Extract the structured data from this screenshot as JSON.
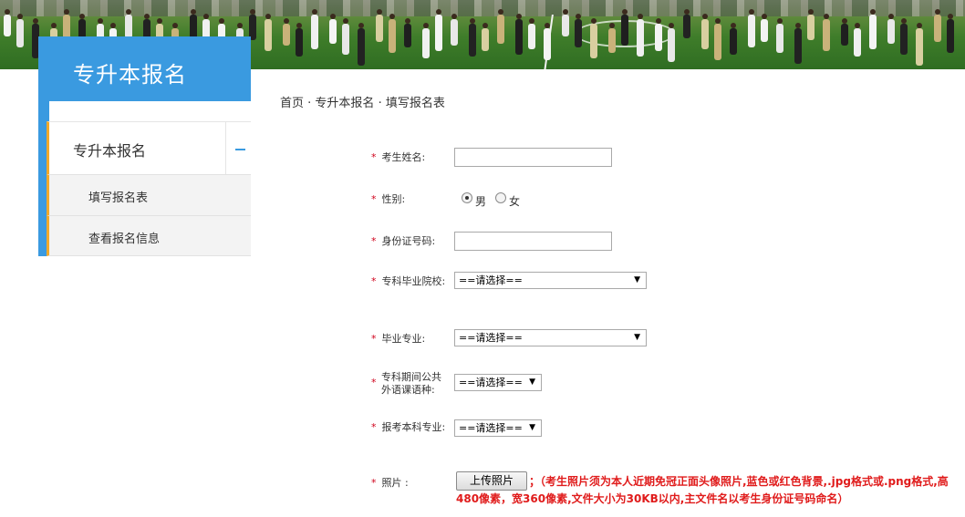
{
  "sidebar": {
    "title": "专升本报名",
    "menu_item": "专升本报名",
    "submenu": [
      "填写报名表",
      "查看报名信息"
    ]
  },
  "breadcrumb": {
    "home": "首页",
    "sep": " · ",
    "section": "专升本报名",
    "current": "填写报名表"
  },
  "form": {
    "required_mark": "*",
    "name_label": "考生姓名:",
    "gender_label": "性别:",
    "gender_options": [
      "男",
      "女"
    ],
    "gender_selected": "男",
    "id_label": "身份证号码:",
    "college_label": "专科毕业院校:",
    "college_value": "==请选择==",
    "major_label": "毕业专业:",
    "major_value": "==请选择==",
    "lang_label_line1": "专科期间公共",
    "lang_label_line2": "外语课语种:",
    "lang_value": "==请选择==",
    "target_major_label": "报考本科专业:",
    "target_major_value": "==请选择==",
    "photo_label": "照片 :",
    "upload_button": "上传照片",
    "upload_note": "；（考生照片须为本人近期免冠正面头像照片,蓝色或红色背景,.jpg格式或.png格式,高480像素，宽360像素,文件大小为30KB以内,主文件名以考生身份证号码命名）"
  },
  "colors": {
    "accent_blue": "#3a9ae0",
    "accent_orange": "#f0a92a",
    "required_red": "#d0021b",
    "note_red": "#e01b1b"
  },
  "icons": {
    "collapse": "minus-icon",
    "dropdown": "caret-down-icon"
  }
}
